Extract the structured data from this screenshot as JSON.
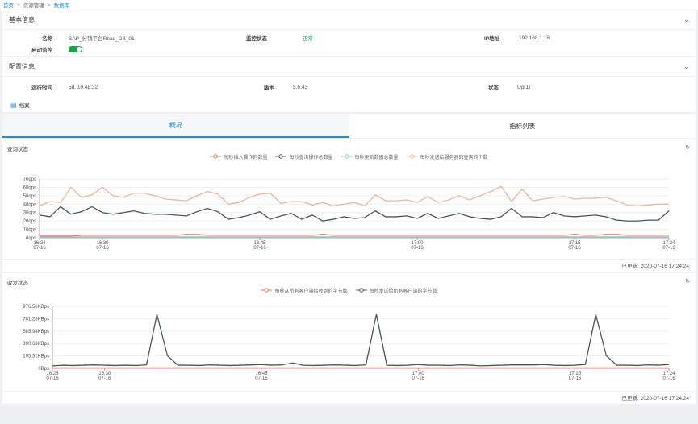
{
  "breadcrumb": {
    "home": "首页",
    "sep": ">",
    "resource": "资源管理",
    "current": "数据库"
  },
  "basic": {
    "title": "基本信息",
    "name_label": "名称",
    "name_value": "SAP_分销平台Read_DB_01",
    "monitor_label": "监控状态",
    "monitor_value": "正常",
    "ip_label": "IP地址",
    "ip_value": "192.168.1.18",
    "enable_label": "启动监控",
    "enable_on": true
  },
  "config": {
    "title": "配置信息",
    "uptime_label": "运行时间",
    "uptime_value": "5d, 10:48:32",
    "version_label": "版本",
    "version_value": "5.6.43",
    "status_label": "状态",
    "status_value": "Up(1)"
  },
  "archive_label": "档案",
  "tabs": [
    {
      "label": "概况",
      "active": true
    },
    {
      "label": "指标列表",
      "active": false
    }
  ],
  "colors": {
    "accent": "#1a8fd8",
    "green": "#1aa34a",
    "series_red": "#e8998a",
    "series_dark": "#4a5560",
    "series_teal": "#8ec9c8",
    "series_peach": "#e8b8a0"
  },
  "chart1": {
    "title": "查询状态",
    "updated": "已更新: 2020-07-16 17:24:24",
    "chart_data": {
      "type": "line",
      "title": "查询状态",
      "y_ticks": [
        "70qps",
        "60qps",
        "50qps",
        "40qps",
        "30qps",
        "20qps",
        "10qps",
        "0qps"
      ],
      "ylim": [
        0,
        70
      ],
      "x_ticks": [
        {
          "t": 0,
          "l1": "16:24",
          "l2": "07-16"
        },
        {
          "t": 6,
          "l1": "16:30",
          "l2": "07-16"
        },
        {
          "t": 21,
          "l1": "16:45",
          "l2": "07-16"
        },
        {
          "t": 36,
          "l1": "17:00",
          "l2": "07-16"
        },
        {
          "t": 51,
          "l1": "17:15",
          "l2": "07-16"
        },
        {
          "t": 60,
          "l1": "17:24",
          "l2": "07-16"
        }
      ],
      "x_range": [
        0,
        60
      ],
      "series": [
        {
          "name": "每秒插入操作的数量",
          "color": "#e07b6a",
          "values": [
            2,
            2,
            2,
            2,
            3,
            3,
            3,
            3,
            3,
            3,
            3,
            3,
            3,
            3,
            4,
            4,
            3,
            3,
            3,
            3,
            3,
            3,
            3,
            3,
            3,
            3,
            3,
            4,
            3,
            3,
            3,
            3,
            3,
            3,
            3,
            3,
            3,
            3,
            3,
            3,
            3,
            3,
            3,
            3,
            3,
            3,
            3,
            3,
            3,
            3,
            3,
            4,
            3,
            3,
            4,
            4,
            3,
            3,
            3,
            3,
            3
          ]
        },
        {
          "name": "每秒查询操作总数量",
          "color": "#4a5560",
          "values": [
            27,
            25,
            37,
            28,
            31,
            37,
            30,
            28,
            30,
            32,
            29,
            28,
            28,
            27,
            26,
            31,
            35,
            31,
            22,
            24,
            27,
            31,
            22,
            26,
            29,
            22,
            27,
            20,
            22,
            25,
            23,
            24,
            32,
            25,
            25,
            26,
            23,
            29,
            23,
            26,
            29,
            25,
            23,
            22,
            25,
            35,
            25,
            25,
            24,
            30,
            26,
            25,
            26,
            27,
            25,
            21,
            20,
            20,
            21,
            21,
            32
          ]
        },
        {
          "name": "每秒更新数据总数量",
          "color": "#8ec9c8",
          "values": [
            1,
            1,
            1,
            1,
            1,
            1,
            1,
            1,
            1,
            1,
            1,
            1,
            1,
            1,
            1,
            1,
            1,
            1,
            1,
            1,
            1,
            1,
            1,
            1,
            1,
            1,
            1,
            1,
            1,
            1,
            1,
            1,
            1,
            1,
            1,
            1,
            1,
            1,
            1,
            1,
            1,
            1,
            1,
            1,
            1,
            1,
            1,
            1,
            1,
            1,
            1,
            1,
            1,
            1,
            1,
            1,
            1,
            1,
            1,
            1,
            1
          ]
        },
        {
          "name": "每秒发送给服务器的查询的个数",
          "color": "#e8b8a0",
          "values": [
            38,
            43,
            42,
            60,
            48,
            51,
            60,
            50,
            48,
            53,
            53,
            50,
            46,
            45,
            44,
            50,
            55,
            52,
            40,
            42,
            48,
            52,
            53,
            41,
            43,
            43,
            39,
            42,
            38,
            40,
            42,
            38,
            51,
            44,
            44,
            45,
            42,
            49,
            42,
            45,
            50,
            45,
            50,
            55,
            61,
            43,
            58,
            44,
            46,
            48,
            49,
            46,
            47,
            47,
            48,
            44,
            39,
            38,
            39,
            40,
            40
          ]
        }
      ]
    }
  },
  "chart2": {
    "title": "收发状态",
    "updated": "已更新: 2020-07-16 17:24:24",
    "chart_data": {
      "type": "line",
      "title": "收发状态",
      "y_ticks": [
        "976.56KBps",
        "781.25KBps",
        "585.94KBps",
        "390.63KBps",
        "195.31KBps",
        "0Bps"
      ],
      "ylim": [
        0,
        976.56
      ],
      "x_ticks": [
        {
          "t": 0,
          "l1": "16:25",
          "l2": "07-16"
        },
        {
          "t": 5,
          "l1": "16:30",
          "l2": "07-16"
        },
        {
          "t": 20,
          "l1": "16:45",
          "l2": "07-16"
        },
        {
          "t": 35,
          "l1": "17:00",
          "l2": "07-16"
        },
        {
          "t": 50,
          "l1": "17:15",
          "l2": "07-16"
        },
        {
          "t": 59,
          "l1": "17:24",
          "l2": "07-16"
        }
      ],
      "x_range": [
        0,
        59
      ],
      "series": [
        {
          "name": "每秒从所有客户端接收到的字节数",
          "color": "#e07b6a",
          "values": [
            8,
            8,
            8,
            8,
            8,
            8,
            8,
            8,
            8,
            8,
            8,
            8,
            8,
            8,
            8,
            8,
            8,
            8,
            8,
            8,
            8,
            8,
            8,
            8,
            8,
            8,
            8,
            8,
            8,
            8,
            8,
            8,
            8,
            8,
            8,
            8,
            8,
            8,
            8,
            8,
            8,
            8,
            8,
            8,
            8,
            8,
            8,
            8,
            8,
            8,
            8,
            8,
            8,
            8,
            8,
            8,
            8,
            8,
            8,
            8
          ]
        },
        {
          "name": "每秒发送给所有客户端的字节数",
          "color": "#4a5560",
          "values": [
            40,
            50,
            45,
            50,
            55,
            50,
            45,
            50,
            45,
            55,
            850,
            200,
            50,
            50,
            45,
            55,
            50,
            45,
            50,
            55,
            60,
            50,
            55,
            85,
            50,
            45,
            50,
            55,
            50,
            45,
            55,
            850,
            50,
            45,
            50,
            60,
            50,
            50,
            45,
            55,
            50,
            40,
            45,
            50,
            55,
            55,
            55,
            60,
            50,
            45,
            50,
            60,
            850,
            200,
            50,
            50,
            45,
            55,
            50,
            60
          ]
        }
      ]
    }
  }
}
